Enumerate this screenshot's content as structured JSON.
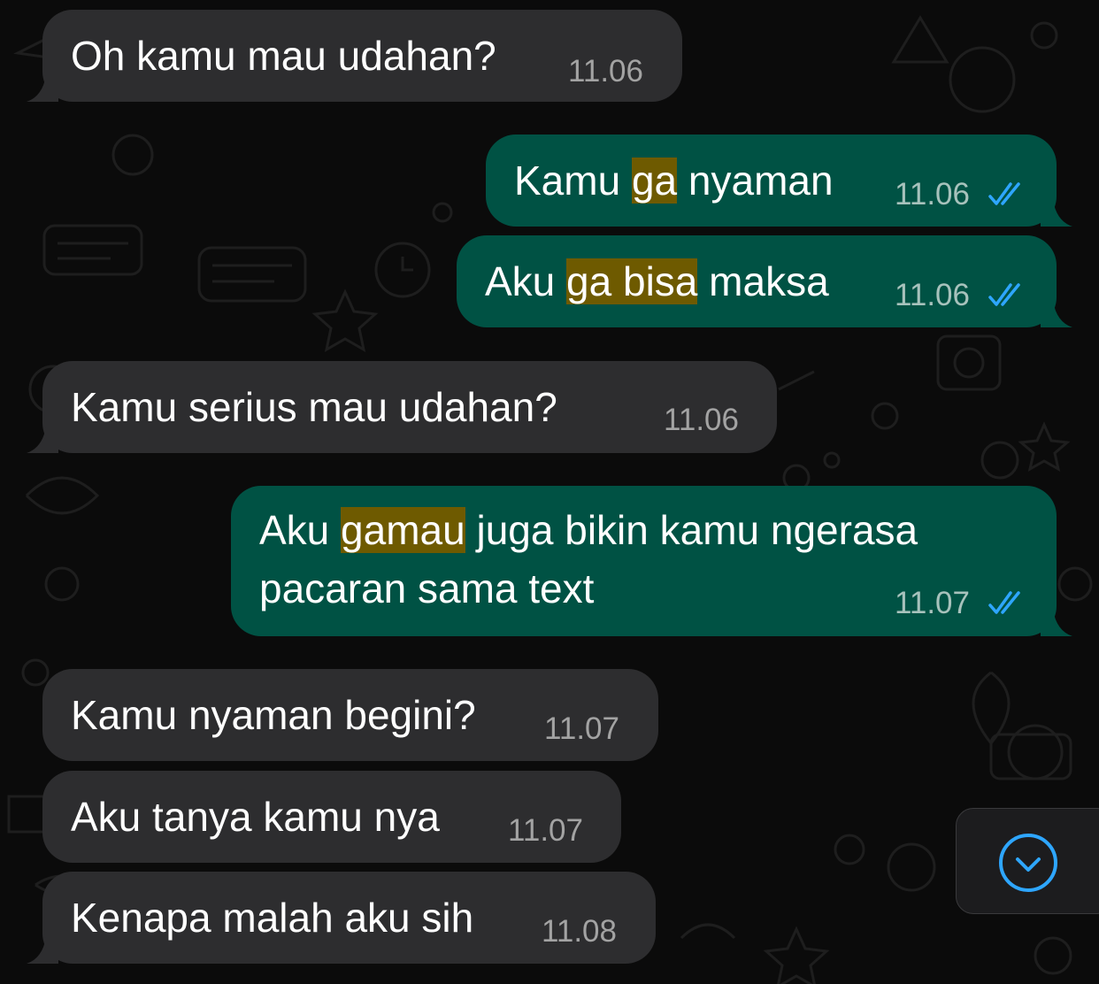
{
  "colors": {
    "background": "#0b0b0b",
    "incoming_bubble": "#2d2d2f",
    "outgoing_bubble": "#005244",
    "highlight": "#6e5a00",
    "read_ticks": "#2ea6ff",
    "scroll_button_accent": "#2ea6ff"
  },
  "messages": [
    {
      "direction": "incoming",
      "before": "Oh kamu mau udahan?",
      "highlight": "",
      "after": "",
      "line2": "",
      "time": "11.06"
    },
    {
      "direction": "outgoing",
      "before": "Kamu ",
      "highlight": "ga",
      "after": " nyaman",
      "line2": "",
      "time": "11.06",
      "status": "read"
    },
    {
      "direction": "outgoing",
      "before": "Aku ",
      "highlight": "ga bisa",
      "after": " maksa",
      "line2": "",
      "time": "11.06",
      "status": "read"
    },
    {
      "direction": "incoming",
      "before": "Kamu serius mau udahan?",
      "highlight": "",
      "after": "",
      "line2": "",
      "time": "11.06"
    },
    {
      "direction": "outgoing",
      "before": "Aku ",
      "highlight": "gamau",
      "after": " juga bikin kamu ngerasa",
      "line2": "pacaran sama text",
      "time": "11.07",
      "status": "read"
    },
    {
      "direction": "incoming",
      "before": "Kamu nyaman begini?",
      "highlight": "",
      "after": "",
      "line2": "",
      "time": "11.07"
    },
    {
      "direction": "incoming",
      "before": "Aku tanya kamu nya",
      "highlight": "",
      "after": "",
      "line2": "",
      "time": "11.07"
    },
    {
      "direction": "incoming",
      "before": "Kenapa malah aku sih",
      "highlight": "",
      "after": "",
      "line2": "",
      "time": "11.08"
    }
  ],
  "scroll_button": {
    "icon": "chevron-down-circle-icon"
  }
}
